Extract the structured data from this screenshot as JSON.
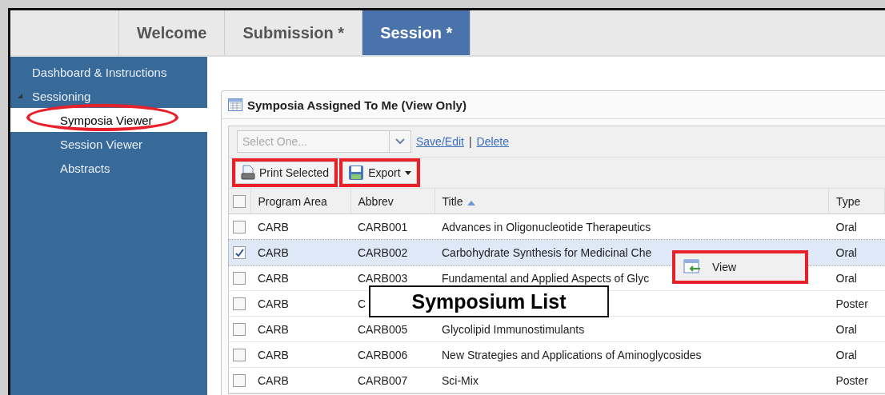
{
  "tabs": [
    {
      "label": "Welcome",
      "selected": false
    },
    {
      "label": "Submission *",
      "selected": false
    },
    {
      "label": "Session *",
      "selected": true
    }
  ],
  "sidebar": {
    "items": [
      {
        "label": "Dashboard & Instructions",
        "selected": false,
        "highlighted": false
      },
      {
        "label": "Sessioning",
        "selected": false,
        "highlighted": false,
        "expanded": true,
        "children": [
          {
            "label": "Symposia Viewer",
            "selected": true,
            "highlighted": true
          },
          {
            "label": "Session Viewer",
            "selected": false,
            "highlighted": false
          },
          {
            "label": "Abstracts",
            "selected": false,
            "highlighted": false
          }
        ]
      }
    ]
  },
  "panel": {
    "title": "Symposia Assigned To Me (View Only)",
    "select": {
      "placeholder": "Select One..."
    },
    "links": [
      "Save/Edit",
      "|",
      "Delete"
    ],
    "buttons": [
      {
        "kind": "print",
        "label": "Print Selected",
        "highlighted": true
      },
      {
        "kind": "export",
        "label": "Export",
        "highlighted": true
      }
    ],
    "table": {
      "columns": [
        {
          "label": "Program Area",
          "sorted": false
        },
        {
          "label": "Abbrev",
          "sorted": false
        },
        {
          "label": "Title",
          "sorted": true
        },
        {
          "label": "Type",
          "sorted": false
        }
      ],
      "header_checked": false,
      "rows": [
        {
          "checked": false,
          "cells": [
            "CARB",
            "CARB001",
            "Advances in Oligonucleotide Therapeutics",
            "Oral"
          ]
        },
        {
          "checked": true,
          "cells": [
            "CARB",
            "CARB002",
            "Carbohydrate Synthesis for Medicinal Che",
            "Oral"
          ]
        },
        {
          "checked": false,
          "cells": [
            "CARB",
            "CARB003",
            "Fundamental and Applied Aspects of Glyc",
            "Oral"
          ]
        },
        {
          "checked": false,
          "cells": [
            "CARB",
            "C",
            "",
            "Poster"
          ]
        },
        {
          "checked": false,
          "cells": [
            "CARB",
            "CARB005",
            "Glycolipid Immunostimulants",
            "Oral"
          ]
        },
        {
          "checked": false,
          "cells": [
            "CARB",
            "CARB006",
            "New Strategies and Applications of Aminoglycosides",
            "Oral"
          ]
        },
        {
          "checked": false,
          "cells": [
            "CARB",
            "CARB007",
            "Sci-Mix",
            "Poster"
          ]
        }
      ]
    },
    "context_menu": {
      "items": [
        {
          "label": "View",
          "highlighted": true
        }
      ]
    },
    "callout": "Symposium List"
  }
}
